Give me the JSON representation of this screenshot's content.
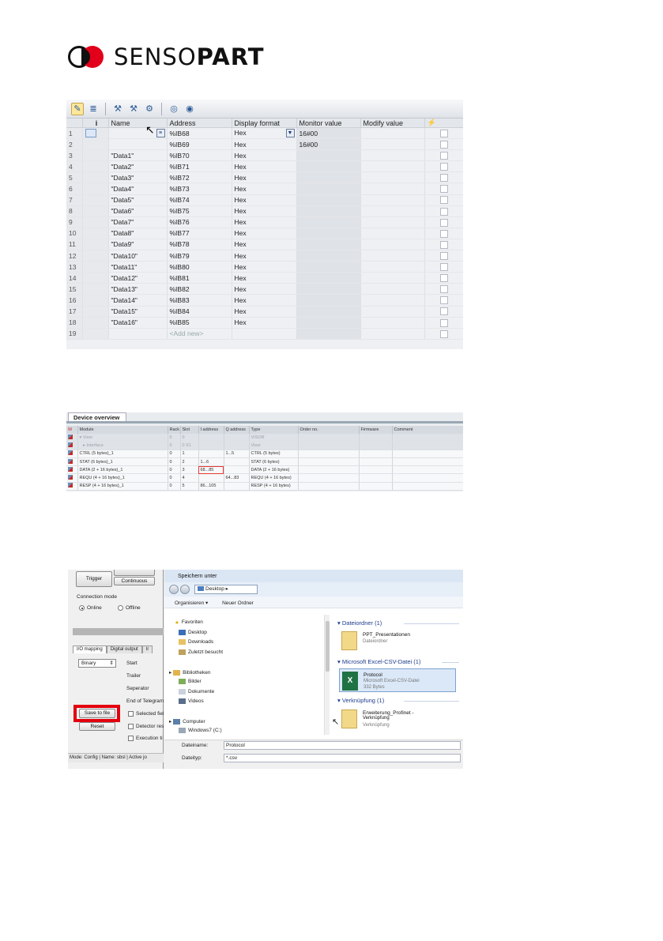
{
  "logo": {
    "brand_regular": "SENSO",
    "brand_bold": "PART"
  },
  "watch_table": {
    "headers": [
      "",
      "i",
      "Name",
      "Address",
      "Display format",
      "Monitor value",
      "Modify value",
      ""
    ],
    "rows": [
      {
        "n": "1",
        "name": "",
        "addr": "%IB68",
        "fmt": "Hex",
        "mon": "16#00"
      },
      {
        "n": "2",
        "name": "",
        "addr": "%IB69",
        "fmt": "Hex",
        "mon": "16#00"
      },
      {
        "n": "3",
        "name": "\"Data1\"",
        "addr": "%IB70",
        "fmt": "Hex",
        "mon": ""
      },
      {
        "n": "4",
        "name": "\"Data2\"",
        "addr": "%IB71",
        "fmt": "Hex",
        "mon": ""
      },
      {
        "n": "5",
        "name": "\"Data3\"",
        "addr": "%IB72",
        "fmt": "Hex",
        "mon": ""
      },
      {
        "n": "6",
        "name": "\"Data4\"",
        "addr": "%IB73",
        "fmt": "Hex",
        "mon": ""
      },
      {
        "n": "7",
        "name": "\"Data5\"",
        "addr": "%IB74",
        "fmt": "Hex",
        "mon": ""
      },
      {
        "n": "8",
        "name": "\"Data6\"",
        "addr": "%IB75",
        "fmt": "Hex",
        "mon": ""
      },
      {
        "n": "9",
        "name": "\"Data7\"",
        "addr": "%IB76",
        "fmt": "Hex",
        "mon": ""
      },
      {
        "n": "10",
        "name": "\"Data8\"",
        "addr": "%IB77",
        "fmt": "Hex",
        "mon": ""
      },
      {
        "n": "11",
        "name": "\"Data9\"",
        "addr": "%IB78",
        "fmt": "Hex",
        "mon": ""
      },
      {
        "n": "12",
        "name": "\"Data10\"",
        "addr": "%IB79",
        "fmt": "Hex",
        "mon": ""
      },
      {
        "n": "13",
        "name": "\"Data11\"",
        "addr": "%IB80",
        "fmt": "Hex",
        "mon": ""
      },
      {
        "n": "14",
        "name": "\"Data12\"",
        "addr": "%IB81",
        "fmt": "Hex",
        "mon": ""
      },
      {
        "n": "15",
        "name": "\"Data13\"",
        "addr": "%IB82",
        "fmt": "Hex",
        "mon": ""
      },
      {
        "n": "16",
        "name": "\"Data14\"",
        "addr": "%IB83",
        "fmt": "Hex",
        "mon": ""
      },
      {
        "n": "17",
        "name": "\"Data15\"",
        "addr": "%IB84",
        "fmt": "Hex",
        "mon": ""
      },
      {
        "n": "18",
        "name": "\"Data16\"",
        "addr": "%IB85",
        "fmt": "Hex",
        "mon": ""
      },
      {
        "n": "19",
        "name": "",
        "addr": "<Add new>",
        "fmt": "",
        "mon": ""
      }
    ]
  },
  "device_overview": {
    "tab": "Device overview",
    "headers": [
      "",
      "Module",
      "Rack",
      "Slot",
      "I address",
      "Q address",
      "Type",
      "Order no.",
      "Firmware",
      "Comment"
    ],
    "rows": [
      {
        "module": "▾ Visor",
        "rack": "0",
        "slot": "0",
        "i": "",
        "q": "",
        "type": "VISOR",
        "style": "grey"
      },
      {
        "module": "   ▸ Interface",
        "rack": "0",
        "slot": "0 X1",
        "i": "",
        "q": "",
        "type": "Visor",
        "style": "grey"
      },
      {
        "module": "CTRL (5 bytes)_1",
        "rack": "0",
        "slot": "1",
        "i": "",
        "q": "1...5",
        "type": "CTRL (5 bytes)",
        "style": "white"
      },
      {
        "module": "STAT (6 bytes)_1",
        "rack": "0",
        "slot": "2",
        "i": "1...6",
        "q": "",
        "type": "STAT (6 bytes)",
        "style": "white"
      },
      {
        "module": "DATA (2 + 16 bytes)_1",
        "rack": "0",
        "slot": "3",
        "i": "68...85",
        "q": "",
        "type": "DATA (2 + 16 bytes)",
        "style": "white"
      },
      {
        "module": "REQU (4 + 16 bytes)_1",
        "rack": "0",
        "slot": "4",
        "i": "",
        "q": "64...83",
        "type": "REQU (4 + 16 bytes)",
        "style": "white"
      },
      {
        "module": "RESP (4 + 16 bytes)_1",
        "rack": "0",
        "slot": "5",
        "i": "86...105",
        "q": "",
        "type": "RESP (4 + 16 bytes)",
        "style": "white"
      }
    ]
  },
  "vision_app": {
    "trigger": "Trigger",
    "continuous": "Continuous",
    "connection_mode": "Connection mode",
    "online": "Online",
    "offline": "Offline",
    "tabs": [
      "I/O mapping",
      "Digital output",
      "Ir"
    ],
    "format": "Binary",
    "start": "Start",
    "trailer": "Trailer",
    "separator": "Seperator",
    "end": "End of Telegram",
    "selected": "Selected fiel",
    "detector": "Detector res",
    "execution": "Execution ti",
    "save_to_file": "Save to file",
    "reset": "Reset",
    "status": "Mode:  Config  |  Name:  sbsl  |  Active jo"
  },
  "save_dialog": {
    "title": "Speichern unter",
    "path": "Desktop",
    "organize": "Organisieren ▾",
    "new_folder": "Neuer Ordner",
    "tree": [
      "Favoriten",
      "Desktop",
      "Downloads",
      "Zuletzt besucht",
      "Bibliotheken",
      "Bilder",
      "Dokumente",
      "Videos",
      "Computer",
      "Windows7 (C:)"
    ],
    "group1": "Dateiordner (1)",
    "file1_name": "PPT_Presentationen",
    "file1_type": "Dateiordner",
    "group2": "Microsoft Excel-CSV-Datei (1)",
    "file2_name": "Protocol",
    "file2_type": "Microsoft Excel-CSV-Datei",
    "file2_size": "332 Bytes",
    "group3": "Verknüpfung (1)",
    "file3_name": "Erweiterung_Profinet -",
    "file3_name2": "Verknüpfung",
    "file3_type": "Verknüpfung",
    "filename_label": "Dateiname:",
    "filename_value": "Protocol",
    "filetype_label": "Dateityp:",
    "filetype_value": "*.csv"
  },
  "colors": {
    "brand_red": "#e2001a",
    "highlight_red": "#e3000f"
  }
}
